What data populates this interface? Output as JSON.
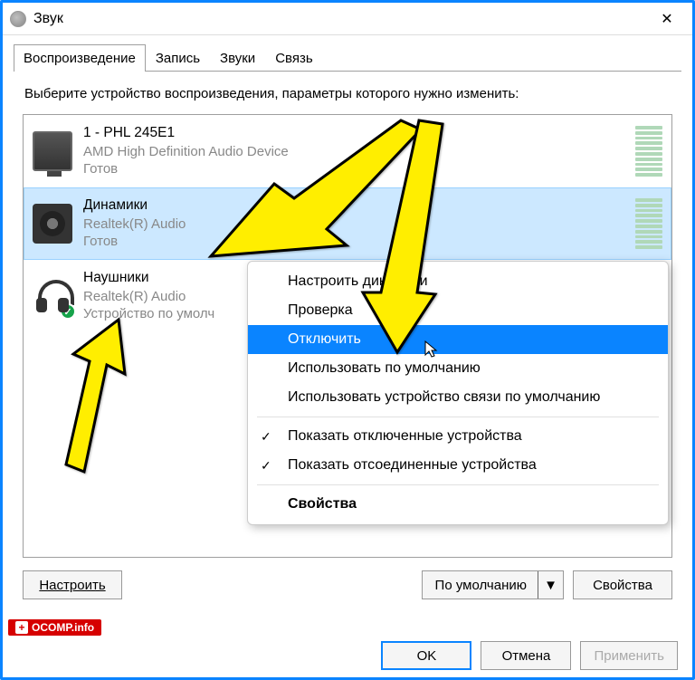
{
  "window": {
    "title": "Звук"
  },
  "tabs": [
    {
      "label": "Воспроизведение",
      "active": true
    },
    {
      "label": "Запись",
      "active": false
    },
    {
      "label": "Звуки",
      "active": false
    },
    {
      "label": "Связь",
      "active": false
    }
  ],
  "instruction": "Выберите устройство воспроизведения, параметры которого нужно изменить:",
  "devices": [
    {
      "name": "1 - PHL 245E1",
      "desc": "AMD High Definition Audio Device",
      "status": "Готов",
      "icon": "monitor",
      "selected": false,
      "default": false
    },
    {
      "name": "Динамики",
      "desc": "Realtek(R) Audio",
      "status": "Готов",
      "icon": "speaker",
      "selected": true,
      "default": false
    },
    {
      "name": "Наушники",
      "desc": "Realtek(R) Audio",
      "status": "Устройство по умолч",
      "icon": "headphones",
      "selected": false,
      "default": true
    }
  ],
  "panel_buttons": {
    "configure": "Настроить",
    "default": "По умолчанию",
    "properties": "Свойства"
  },
  "footer_buttons": {
    "ok": "OK",
    "cancel": "Отмена",
    "apply": "Применить"
  },
  "context_menu": [
    {
      "label": "Настроить динамики",
      "type": "item"
    },
    {
      "label": "Проверка",
      "type": "item"
    },
    {
      "label": "Отключить",
      "type": "item",
      "highlight": true
    },
    {
      "label": "Использовать по умолчанию",
      "type": "item"
    },
    {
      "label": "Использовать устройство связи по умолчанию",
      "type": "item"
    },
    {
      "type": "separator"
    },
    {
      "label": "Показать отключенные устройства",
      "type": "item",
      "checked": true
    },
    {
      "label": "Показать отсоединенные устройства",
      "type": "item",
      "checked": true
    },
    {
      "type": "separator"
    },
    {
      "label": "Свойства",
      "type": "item",
      "bold": true
    }
  ],
  "watermark": "OCOMP.info"
}
